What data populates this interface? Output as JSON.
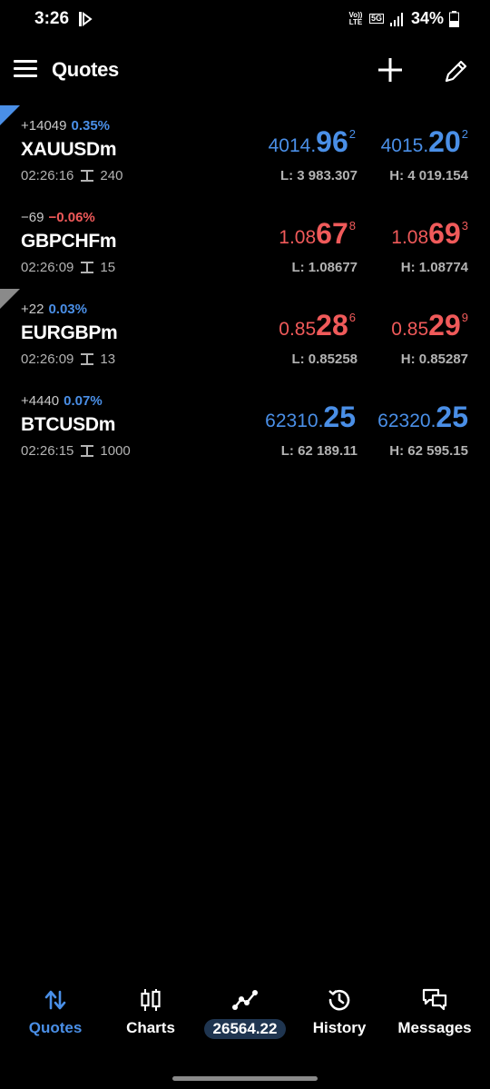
{
  "status_bar": {
    "time": "3:26",
    "volte": "Vo)) LTE",
    "network": "5G",
    "battery": "34%"
  },
  "header": {
    "title": "Quotes",
    "icons": [
      "menu-icon",
      "add-icon",
      "edit-icon"
    ]
  },
  "colors": {
    "up": "#4a8fe7",
    "down": "#f05a5a",
    "muted": "#b3b3b3",
    "background": "#000000"
  },
  "quotes": [
    {
      "change_points": "+14049",
      "change_percent": "0.35%",
      "direction": "up",
      "symbol": "XAUUSDm",
      "time": "02:26:16",
      "spread": "240",
      "bid": {
        "pre": "4014.",
        "big": "96",
        "sup": "2"
      },
      "ask": {
        "pre": "4015.",
        "big": "20",
        "sup": "2"
      },
      "low": "L: 3 983.307",
      "high": "H: 4 019.154"
    },
    {
      "change_points": "−69",
      "change_percent": "−0.06%",
      "direction": "down",
      "symbol": "GBPCHFm",
      "time": "02:26:09",
      "spread": "15",
      "bid": {
        "pre": "1.08",
        "big": "67",
        "sup": "8"
      },
      "ask": {
        "pre": "1.08",
        "big": "69",
        "sup": "3"
      },
      "low": "L: 1.08677",
      "high": "H: 1.08774"
    },
    {
      "change_points": "+22",
      "change_percent": "0.03%",
      "direction": "down",
      "symbol": "EURGBPm",
      "time": "02:26:09",
      "spread": "13",
      "bid": {
        "pre": "0.85",
        "big": "28",
        "sup": "6"
      },
      "ask": {
        "pre": "0.85",
        "big": "29",
        "sup": "9"
      },
      "low": "L: 0.85258",
      "high": "H: 0.85287"
    },
    {
      "change_points": "+4440",
      "change_percent": "0.07%",
      "direction": "up",
      "symbol": "BTCUSDm",
      "time": "02:26:15",
      "spread": "1000",
      "bid": {
        "pre": "62310.",
        "big": "25",
        "sup": ""
      },
      "ask": {
        "pre": "62320.",
        "big": "25",
        "sup": ""
      },
      "low": "L: 62 189.11",
      "high": "H: 62 595.15"
    }
  ],
  "bottom_nav": {
    "quotes_label": "Quotes",
    "charts_label": "Charts",
    "balance": "26564.22",
    "history_label": "History",
    "messages_label": "Messages"
  }
}
